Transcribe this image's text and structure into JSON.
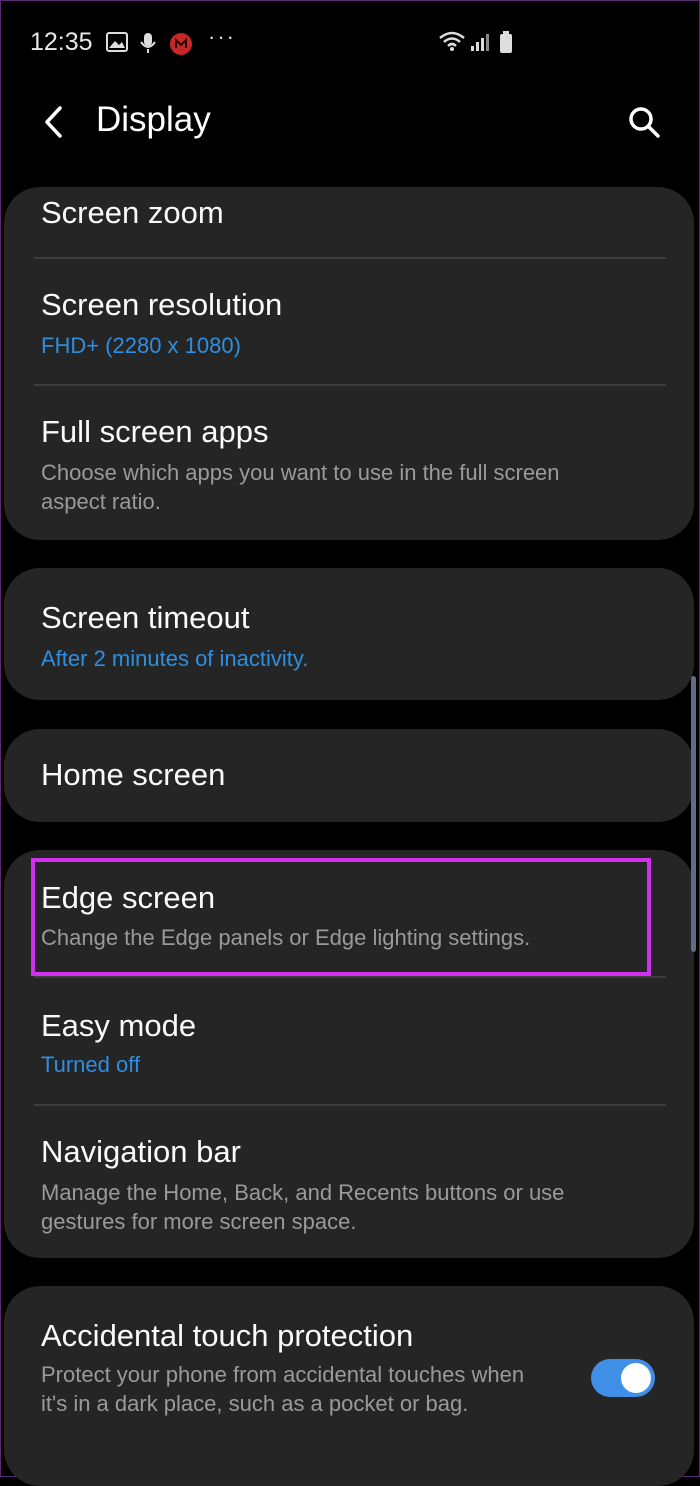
{
  "status_bar": {
    "time": "12:35",
    "icons": [
      "image-icon",
      "mic-icon",
      "notification-icon",
      "more-dots-icon",
      "wifi-icon",
      "signal-icon",
      "battery-icon"
    ],
    "overflow": "···"
  },
  "header": {
    "title": "Display",
    "back_icon": "back-arrow-icon",
    "search_icon": "search-icon"
  },
  "items": {
    "screen_zoom": {
      "title": "Screen zoom"
    },
    "screen_resolution": {
      "title": "Screen resolution",
      "value": "FHD+ (2280 x 1080)"
    },
    "full_screen_apps": {
      "title": "Full screen apps",
      "description": "Choose which apps you want to use in the full screen aspect ratio."
    },
    "screen_timeout": {
      "title": "Screen timeout",
      "value": "After 2 minutes of inactivity."
    },
    "home_screen": {
      "title": "Home screen"
    },
    "edge_screen": {
      "title": "Edge screen",
      "description": "Change the Edge panels or Edge lighting settings."
    },
    "easy_mode": {
      "title": "Easy mode",
      "value": "Turned off"
    },
    "navigation_bar": {
      "title": "Navigation bar",
      "description": "Manage the Home, Back, and Recents buttons or use gestures for more screen space."
    },
    "accidental_touch": {
      "title": "Accidental touch protection",
      "description": "Protect your phone from accidental touches when it's in a dark place, such as a pocket or bag.",
      "enabled": true
    }
  },
  "colors": {
    "background": "#000000",
    "card": "#252525",
    "accent_blue": "#2e8ee0",
    "toggle_on": "#3f8fe6",
    "highlight": "#d32ff0"
  }
}
